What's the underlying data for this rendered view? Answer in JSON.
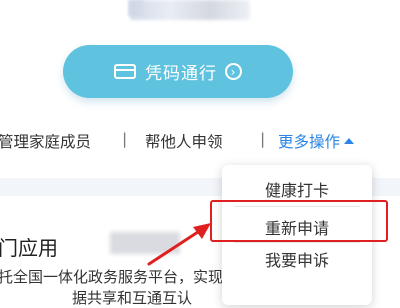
{
  "pass_button": {
    "label": "凭码通行",
    "icon": "card-icon",
    "go_icon": "chevron-right-circle-icon"
  },
  "actions": {
    "manage_family": "管理家庭成员",
    "separator": "|",
    "claim_for_others": "帮他人申领",
    "more_actions": "更多操作"
  },
  "dropdown": {
    "items": [
      "健康打卡",
      "重新申请",
      "我要申诉"
    ],
    "highlighted": "重新申请"
  },
  "section": {
    "title": "门应用",
    "desc_line1": "托全国一体化政务服务平台，实现跨省（区、市）数",
    "desc_line2": "据共享和互通互认"
  },
  "colors": {
    "pass_button": "#5fc3df",
    "link": "#2a86e6",
    "highlight": "#e02020"
  }
}
